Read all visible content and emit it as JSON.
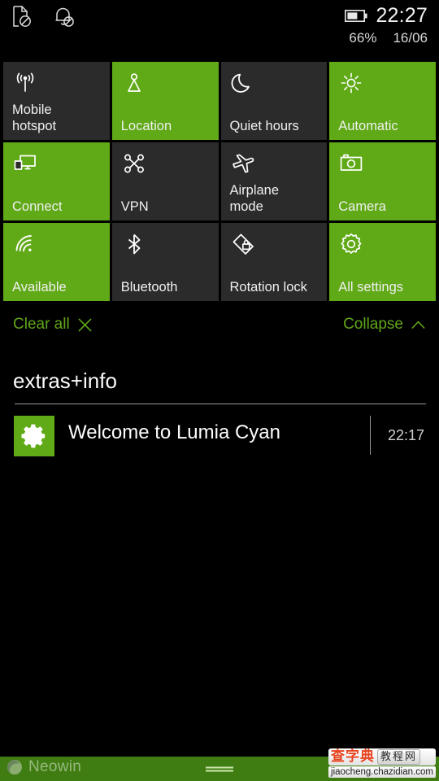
{
  "status_bar": {
    "left_icons": [
      {
        "name": "sim-disabled-icon",
        "label": "SIM disabled"
      },
      {
        "name": "ringer-off-icon",
        "label": "Ringer off"
      }
    ],
    "battery_icon": "battery-icon",
    "time": "22:27",
    "battery_percent": "66%",
    "date": "16/06"
  },
  "quick_actions": {
    "tiles": [
      {
        "icon": "wifi-hotspot-icon",
        "label": "Mobile\nhotspot",
        "state": "off"
      },
      {
        "icon": "location-pin-icon",
        "label": "Location",
        "state": "on"
      },
      {
        "icon": "moon-icon",
        "label": "Quiet hours",
        "state": "off"
      },
      {
        "icon": "brightness-sun-icon",
        "label": "Automatic",
        "state": "on"
      },
      {
        "icon": "connect-display-icon",
        "label": "Connect",
        "state": "on"
      },
      {
        "icon": "vpn-icon",
        "label": "VPN",
        "state": "off"
      },
      {
        "icon": "airplane-icon",
        "label": "Airplane\nmode",
        "state": "off"
      },
      {
        "icon": "camera-icon",
        "label": "Camera",
        "state": "on"
      },
      {
        "icon": "wifi-signal-icon",
        "label": "Available",
        "state": "on"
      },
      {
        "icon": "bluetooth-icon",
        "label": "Bluetooth",
        "state": "off"
      },
      {
        "icon": "rotation-lock-icon",
        "label": "Rotation lock",
        "state": "off"
      },
      {
        "icon": "gear-icon",
        "label": "All settings",
        "state": "on"
      }
    ]
  },
  "actions": {
    "clear_all_label": "Clear all",
    "clear_all_icon": "close-x-icon",
    "collapse_label": "Collapse",
    "collapse_icon": "chevron-up-icon"
  },
  "notification_group": {
    "title": "extras+info",
    "notifications": [
      {
        "app_icon": "gear-icon",
        "title": "Welcome to Lumia Cyan",
        "time": "22:17"
      }
    ]
  },
  "nav_bar": {
    "handle_icon": "nav-minimize-handle-icon"
  },
  "watermarks": {
    "neowin": "Neowin",
    "chazidian_cn": "查字典",
    "chazidian_box": "教程网",
    "chazidian_url": "jiaocheng.chazidian.com"
  },
  "colors": {
    "accent_green": "#60a917",
    "tile_off": "#2b2b2b",
    "background": "#000000",
    "nav_bar": "#3f7d12"
  }
}
